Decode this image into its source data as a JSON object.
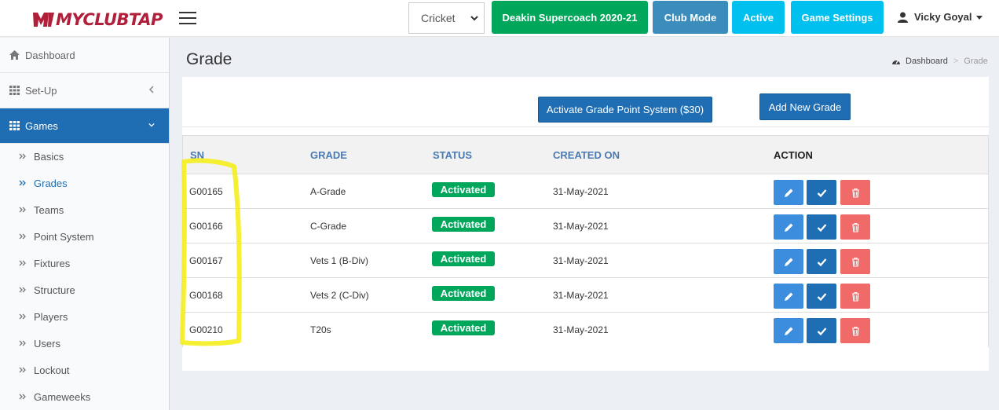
{
  "app": {
    "logo_text": "MYCLUBTAP"
  },
  "topbar": {
    "sport_selected": "Cricket",
    "season_label": "Deakin Supercoach 2020-21",
    "club_mode_label": "Club Mode",
    "active_label": "Active",
    "game_settings_label": "Game Settings",
    "user_name": "Vicky Goyal"
  },
  "sidebar": {
    "dashboard": "Dashboard",
    "setup": "Set-Up",
    "games": "Games",
    "sub_items": [
      "Basics",
      "Grades",
      "Teams",
      "Point System",
      "Fixtures",
      "Structure",
      "Players",
      "Users",
      "Lockout",
      "Gameweeks"
    ]
  },
  "page": {
    "title": "Grade",
    "breadcrumb": {
      "home": "Dashboard",
      "current": "Grade"
    },
    "activate_button": "Activate Grade Point System ($30)",
    "add_button": "Add New Grade"
  },
  "table": {
    "headers": {
      "sn": "SN",
      "grade": "GRADE",
      "status": "STATUS",
      "created_on": "CREATED ON",
      "action": "ACTION"
    },
    "rows": [
      {
        "sn": "G00165",
        "grade": "A-Grade",
        "status": "Activated",
        "created_on": "31-May-2021"
      },
      {
        "sn": "G00166",
        "grade": "C-Grade",
        "status": "Activated",
        "created_on": "31-May-2021"
      },
      {
        "sn": "G00167",
        "grade": "Vets 1 (B-Div)",
        "status": "Activated",
        "created_on": "31-May-2021"
      },
      {
        "sn": "G00168",
        "grade": "Vets 2 (C-Div)",
        "status": "Activated",
        "created_on": "31-May-2021"
      },
      {
        "sn": "G00210",
        "grade": "T20s",
        "status": "Activated",
        "created_on": "31-May-2021"
      }
    ]
  },
  "colors": {
    "primary_blue": "#1f6db3",
    "success_green": "#00a65a",
    "info_cyan": "#00c0ef",
    "danger_red": "#f06a6a",
    "brand_red": "#b0203a",
    "highlight_yellow": "#f5ee1e"
  }
}
